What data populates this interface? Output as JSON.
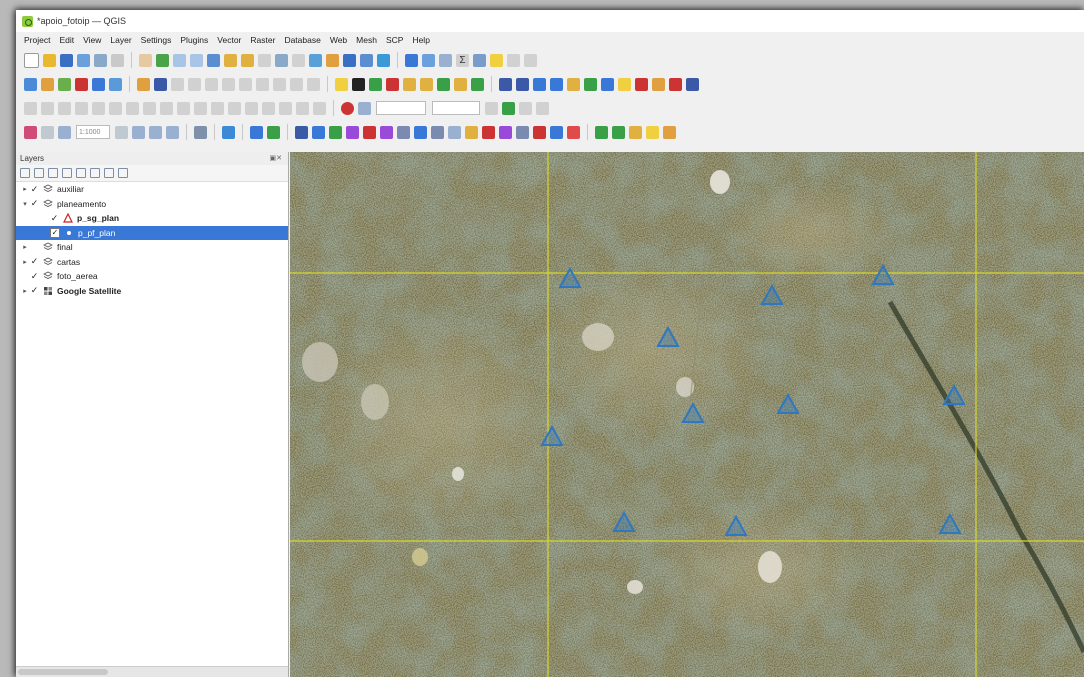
{
  "window": {
    "title": "*apoio_fotoip — QGIS"
  },
  "menu": [
    "Project",
    "Edit",
    "View",
    "Layer",
    "Settings",
    "Plugins",
    "Vector",
    "Raster",
    "Database",
    "Web",
    "Mesh",
    "SCP",
    "Help"
  ],
  "layers_panel": {
    "title": "Layers",
    "items": [
      {
        "label": "auxiliar",
        "checked": true,
        "expander": "▸",
        "indent": 0,
        "bold": false,
        "selected": false,
        "icon": "layer-group-icon"
      },
      {
        "label": "planeamento",
        "checked": true,
        "expander": "▾",
        "indent": 0,
        "bold": false,
        "selected": false,
        "icon": "layer-group-icon"
      },
      {
        "label": "p_sg_plan",
        "checked": true,
        "expander": "",
        "indent": 1,
        "bold": true,
        "selected": false,
        "icon": "point-layer-triangle-icon"
      },
      {
        "label": "p_pf_plan",
        "checked": true,
        "expander": "",
        "indent": 1,
        "bold": false,
        "selected": true,
        "icon": "point-layer-icon"
      },
      {
        "label": "final",
        "checked": false,
        "expander": "▸",
        "indent": 0,
        "bold": false,
        "selected": false,
        "icon": "layer-group-icon"
      },
      {
        "label": "cartas",
        "checked": true,
        "expander": "▸",
        "indent": 0,
        "bold": false,
        "selected": false,
        "icon": "layer-group-icon"
      },
      {
        "label": "foto_aerea",
        "checked": true,
        "expander": "",
        "indent": 0,
        "bold": false,
        "selected": false,
        "icon": "layer-group-icon"
      },
      {
        "label": "Google Satellite",
        "checked": true,
        "expander": "▸",
        "indent": 0,
        "bold": true,
        "selected": false,
        "icon": "xyz-tile-layer-icon"
      }
    ]
  },
  "toolbar": {
    "scale_value": "1:1000"
  },
  "colors": {
    "selection": "#3a78d8",
    "grid_line": "#d6d62a",
    "symbol": "#2f78c0",
    "satellite_dark": "#1f2818"
  }
}
